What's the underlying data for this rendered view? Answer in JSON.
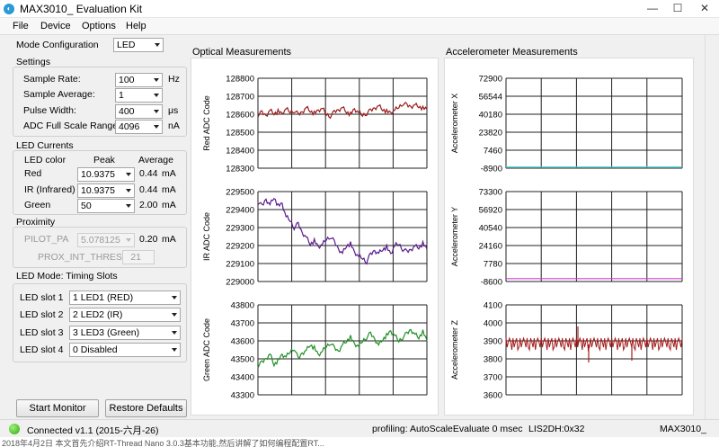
{
  "window": {
    "title": "MAX3010_ Evaluation Kit",
    "min": "—",
    "max": "☐",
    "close": "✕"
  },
  "menu": [
    "File",
    "Device",
    "Options",
    "Help"
  ],
  "mode_config": {
    "label": "Mode Configuration",
    "value": "LED"
  },
  "settings": {
    "title": "Settings",
    "rows": [
      {
        "label": "Sample Rate:",
        "value": "100",
        "unit": "Hz"
      },
      {
        "label": "Sample Average:",
        "value": "1",
        "unit": ""
      },
      {
        "label": "Pulse Width:",
        "value": "400",
        "unit": "μs"
      },
      {
        "label": "ADC Full Scale Range",
        "value": "4096",
        "unit": "nA"
      }
    ]
  },
  "led_currents": {
    "title": "LED Currents",
    "headers": {
      "color": "LED color",
      "peak": "Peak",
      "average": "Average"
    },
    "rows": [
      {
        "label": "Red",
        "peak": "10.9375",
        "average": "0.44",
        "unit": "mA"
      },
      {
        "label": "IR (Infrared)",
        "peak": "10.9375",
        "average": "0.44",
        "unit": "mA"
      },
      {
        "label": "Green",
        "peak": "50",
        "average": "2.00",
        "unit": "mA"
      }
    ]
  },
  "proximity": {
    "title": "Proximity",
    "pilot_label": "PILOT_PA",
    "pilot_value": "5.078125",
    "pilot_avg": "0.20",
    "pilot_unit": "mA",
    "thresh_label": "PROX_INT_THRESH",
    "thresh_value": "21"
  },
  "timing": {
    "title": "LED Mode: Timing Slots",
    "slots": [
      {
        "label": "LED slot 1",
        "value": "1 LED1 (RED)"
      },
      {
        "label": "LED slot 2",
        "value": "2 LED2 (IR)"
      },
      {
        "label": "LED slot 3",
        "value": "3 LED3 (Green)"
      },
      {
        "label": "LED slot 4",
        "value": "0 Disabled"
      }
    ]
  },
  "buttons": {
    "start": "Start Monitor",
    "restore": "Restore Defaults"
  },
  "optical_title": "Optical Measurements",
  "accel_title": "Accelerometer Measurements",
  "chart_data": [
    {
      "type": "line",
      "ylabel": "Red ADC Code",
      "yticks": [
        "128800",
        "128700",
        "128600",
        "128500",
        "128400",
        "128300"
      ],
      "ylim": [
        128300,
        128800
      ],
      "color": "#9b1b1b",
      "grid": true,
      "values": [
        128595,
        128610,
        128590,
        128625,
        128605,
        128615,
        128600,
        128630,
        128612,
        128620,
        128598,
        128610,
        128640,
        128620,
        128605,
        128618,
        128632,
        128600,
        128590,
        128612,
        128622,
        128640,
        128615,
        128600,
        128625,
        128610,
        128595,
        128605,
        128620,
        128632,
        128650,
        128628,
        128615,
        128605,
        128622,
        128640,
        128660,
        128650,
        128640,
        128655,
        128645,
        128632,
        128628
      ]
    },
    {
      "type": "line",
      "ylabel": "IR ADC Code",
      "yticks": [
        "229500",
        "229400",
        "229300",
        "229200",
        "229100",
        "229000"
      ],
      "ylim": [
        229000,
        229500
      ],
      "color": "#5a1a8c",
      "grid": true,
      "values": [
        229440,
        229420,
        229455,
        229430,
        229470,
        229420,
        229430,
        229360,
        229340,
        229300,
        229320,
        229270,
        229250,
        229210,
        229225,
        229190,
        229205,
        229235,
        229250,
        229220,
        229180,
        229160,
        229200,
        229210,
        229160,
        229140,
        229130,
        229110,
        229150,
        229170,
        229160,
        229180,
        229190,
        229150,
        229200,
        229210,
        229180,
        229165,
        229175,
        229200,
        229190,
        229210,
        229180
      ]
    },
    {
      "type": "line",
      "ylabel": "Green ADC Code",
      "yticks": [
        "43800",
        "43700",
        "43600",
        "43500",
        "43400",
        "43300"
      ],
      "ylim": [
        43300,
        43800
      ],
      "color": "#1f8f25",
      "grid": true,
      "values": [
        43460,
        43480,
        43500,
        43530,
        43470,
        43490,
        43520,
        43510,
        43540,
        43560,
        43500,
        43530,
        43550,
        43580,
        43560,
        43520,
        43540,
        43570,
        43590,
        43560,
        43540,
        43580,
        43600,
        43620,
        43580,
        43570,
        43600,
        43620,
        43640,
        43610,
        43580,
        43610,
        43630,
        43650,
        43630,
        43600,
        43620,
        43640,
        43660,
        43640,
        43620,
        43650,
        43600
      ]
    },
    {
      "type": "line",
      "ylabel": "Accelerometer X",
      "yticks": [
        "72900",
        "56544",
        "40180",
        "23820",
        "7460",
        "-8900"
      ],
      "ylim": [
        -8900,
        72900
      ],
      "color": "#4fd8df",
      "grid": true,
      "values": [
        -7800,
        -7800
      ]
    },
    {
      "type": "line",
      "ylabel": "Accelerometer Y",
      "yticks": [
        "73300",
        "56920",
        "40540",
        "24160",
        "7780",
        "-8600"
      ],
      "ylim": [
        -8600,
        73300
      ],
      "color": "#d23ed6",
      "grid": true,
      "values": [
        -6000,
        -6000
      ]
    },
    {
      "type": "line",
      "ylabel": "Accelerometer Z",
      "yticks": [
        "4100",
        "4000",
        "3900",
        "3800",
        "3700",
        "3600"
      ],
      "ylim": [
        3600,
        4100
      ],
      "color": "#a31c1c",
      "grid": true,
      "values": [
        3880
      ]
    }
  ],
  "status": {
    "connection": "Connected v1.1 (2015-六月-26)",
    "profiling": "profiling: AutoScaleEvaluate 0 msec",
    "sensor": "LIS2DH:0x32",
    "device": "MAX3010_"
  },
  "behind_window_text": "2018年4月2日 本文首先介绍RT-Thread Nano 3.0.3基本功能,然后讲解了如何编程配置RT..."
}
